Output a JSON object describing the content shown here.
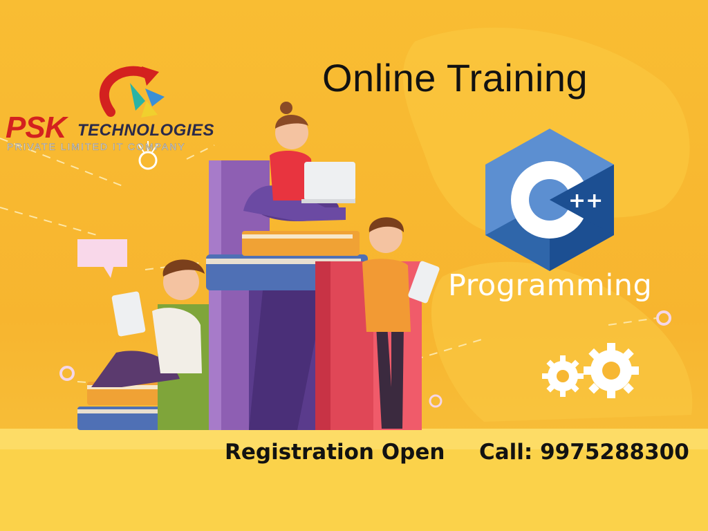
{
  "brand": {
    "name_main": "PSK",
    "name_secondary": "TECHNOLOGIES",
    "tagline": "PRIVATE LIMITED IT COMPANY"
  },
  "headline": "Online Training",
  "course": {
    "logo_text": "C",
    "logo_superscript": "++",
    "label": "Programming"
  },
  "footer": {
    "registration": "Registration Open",
    "call": "Call: 9975288300"
  },
  "colors": {
    "background": "#f7b733",
    "brand_red": "#d3211f",
    "cpp_blue_dark": "#1c4f92",
    "cpp_blue_light": "#5c8fd1",
    "text_dark": "#121212"
  },
  "icons": [
    "psk-swirl-logo-icon",
    "lightbulb-icon",
    "chat-bubble-icon",
    "gear-icon",
    "cpp-hexagon-logo-icon"
  ]
}
